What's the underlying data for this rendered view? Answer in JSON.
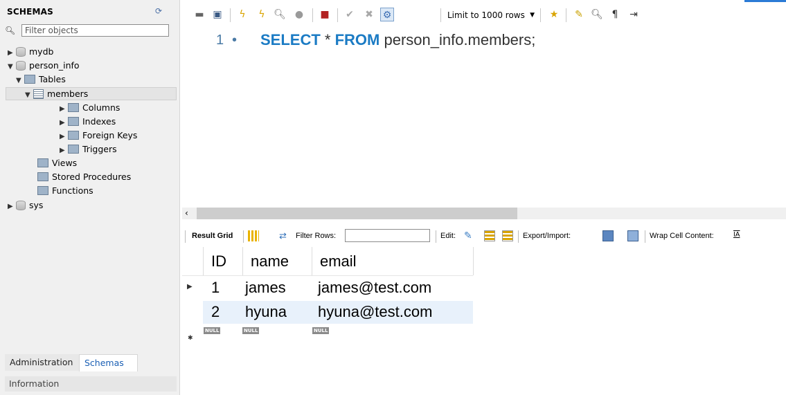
{
  "sidebar": {
    "title": "SCHEMAS",
    "filter_placeholder": "Filter objects",
    "tree": {
      "mydb": "mydb",
      "person_info": "person_info",
      "tables": "Tables",
      "members": "members",
      "columns": "Columns",
      "indexes": "Indexes",
      "foreign_keys": "Foreign Keys",
      "triggers": "Triggers",
      "views": "Views",
      "stored_procedures": "Stored Procedures",
      "functions": "Functions",
      "sys": "sys"
    },
    "tabs": {
      "administration": "Administration",
      "schemas": "Schemas"
    },
    "information": "Information"
  },
  "toolbar": {
    "limit_label": "Limit to 1000 rows"
  },
  "editor": {
    "line_number": "1",
    "line_marker": "•",
    "sql": {
      "select": "SELECT",
      "star": " * ",
      "from": "FROM",
      "target": " person_info.members;"
    }
  },
  "result_toolbar": {
    "result_grid": "Result Grid",
    "filter_rows": "Filter Rows:",
    "edit": "Edit:",
    "export_import": "Export/Import:",
    "wrap_cell": "Wrap Cell Content:"
  },
  "grid": {
    "columns": [
      "ID",
      "name",
      "email"
    ],
    "rows": [
      [
        "1",
        "james",
        "james@test.com"
      ],
      [
        "2",
        "hyuna",
        "hyuna@test.com"
      ]
    ],
    "null_label": "NULL"
  },
  "colors": {
    "keyword": "#1b7bc4",
    "selected_row": "#e8f1fb",
    "accent": "#2b7bd6"
  }
}
